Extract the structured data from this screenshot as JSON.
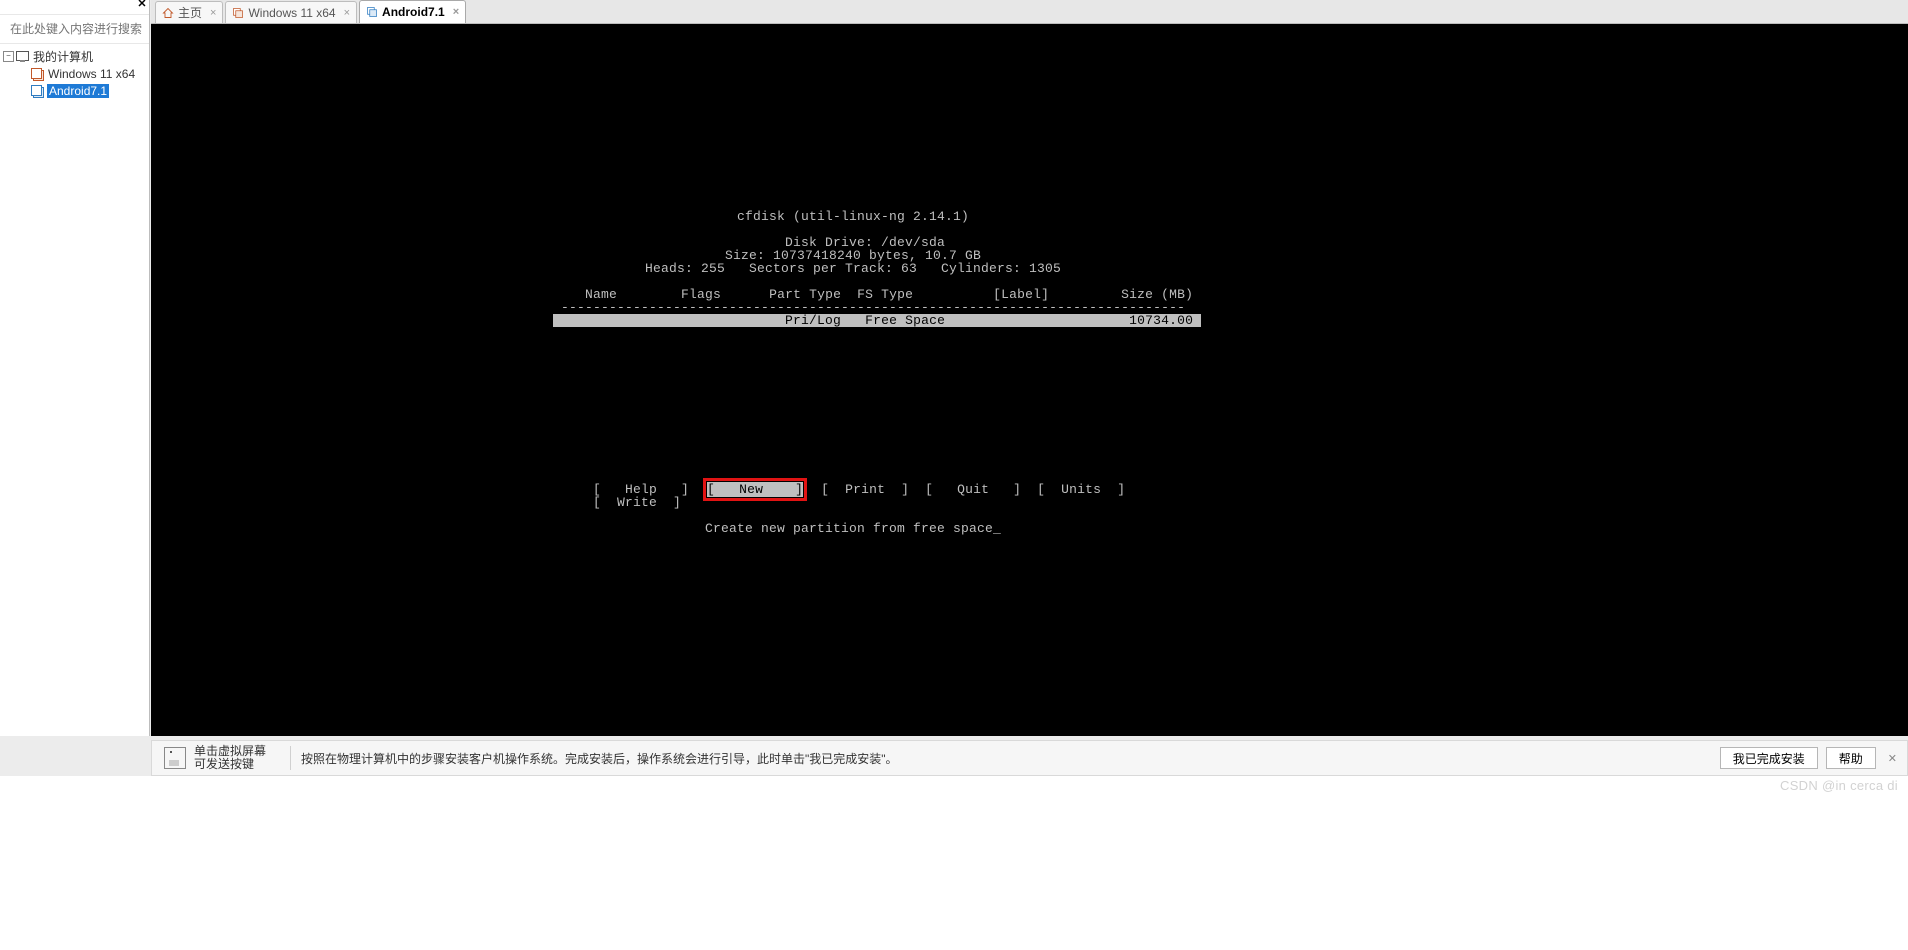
{
  "sidebar": {
    "search_placeholder": "在此处键入内容进行搜索",
    "root_label": "我的计算机",
    "items": [
      {
        "label": "Windows 11 x64",
        "selected": false
      },
      {
        "label": "Android7.1",
        "selected": true
      }
    ]
  },
  "tabs": [
    {
      "label": "主页",
      "kind": "home",
      "active": false
    },
    {
      "label": "Windows 11 x64",
      "kind": "vm",
      "active": false
    },
    {
      "label": "Android7.1",
      "kind": "vm",
      "active": true
    }
  ],
  "cfdisk": {
    "title": "cfdisk (util-linux-ng 2.14.1)",
    "drive": "Disk Drive: /dev/sda",
    "size_line": "Size: 10737418240 bytes, 10.7 GB",
    "geom_line": "Heads: 255   Sectors per Track: 63   Cylinders: 1305",
    "columns": {
      "name": "Name",
      "flags": "Flags",
      "part_type": "Part Type",
      "fs_type": "FS Type",
      "label": "[Label]",
      "size": "Size (MB)"
    },
    "rows": [
      {
        "name": "",
        "flags": "",
        "part_type": "Pri/Log",
        "fs_type": "Free Space",
        "label": "",
        "size": "10734.00",
        "selected": true
      }
    ],
    "menu": [
      {
        "label": "Help",
        "selected": false
      },
      {
        "label": "New",
        "selected": true
      },
      {
        "label": "Print",
        "selected": false
      },
      {
        "label": "Quit",
        "selected": false
      },
      {
        "label": "Units",
        "selected": false
      },
      {
        "label": "Write",
        "selected": false
      }
    ],
    "hint": "Create new partition from free space"
  },
  "hintbar": {
    "line1": "单击虚拟屏幕",
    "line2": "可发送按键",
    "main": "按照在物理计算机中的步骤安装客户机操作系统。完成安装后，操作系统会进行引导，此时单击\"我已完成安装\"。",
    "btn_done": "我已完成安装",
    "btn_help": "帮助"
  },
  "watermark": "CSDN @in cerca di"
}
